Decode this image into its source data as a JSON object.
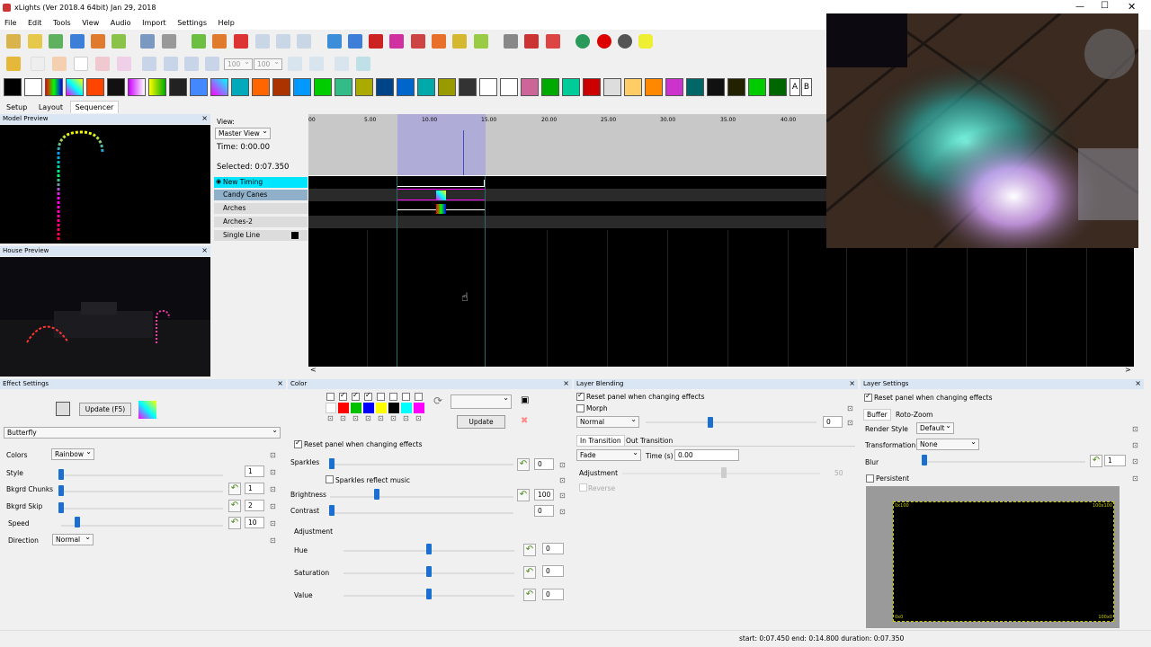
{
  "window": {
    "title": "xLights  (Ver 2018.4 64bit) Jan 29, 2018"
  },
  "menu": [
    "File",
    "Edit",
    "Tools",
    "View",
    "Audio",
    "Import",
    "Settings",
    "Help"
  ],
  "toolbar": {
    "zoom_a": "100",
    "zoom_b": "100"
  },
  "effects_bar": {
    "letter_a": "A",
    "letter_b": "B"
  },
  "tabs": [
    "Setup",
    "Layout",
    "Sequencer"
  ],
  "model_preview": {
    "title": "Model Preview",
    "close": "×"
  },
  "house_preview": {
    "title": "House Preview",
    "close": "×"
  },
  "sequencer": {
    "view_label": "View:",
    "view_value": "Master View",
    "time_label": "Time: 0:00.00",
    "selected_label": "Selected: 0:07.350",
    "ruler": [
      "00",
      "5.00",
      "10.00",
      "15.00",
      "20.00",
      "25.00",
      "30.00",
      "35.00",
      "40.00"
    ],
    "rows": [
      {
        "name": "New Timing"
      },
      {
        "name": "Candy Canes"
      },
      {
        "name": "Arches"
      },
      {
        "name": "Arches-2"
      },
      {
        "name": "Single Line"
      }
    ],
    "scroll_left": "<",
    "scroll_right": ">"
  },
  "effect_settings": {
    "title": "Effect Settings",
    "update_btn": "Update (F5)",
    "effect": "Butterfly",
    "colors_label": "Colors",
    "colors_value": "Rainbow",
    "style_label": "Style",
    "style_value": "1",
    "chunks_label": "Bkgrd Chunks",
    "chunks_value": "1",
    "skip_label": "Bkgrd Skip",
    "skip_value": "2",
    "speed_label": "Speed",
    "speed_value": "10",
    "direction_label": "Direction",
    "direction_value": "Normal",
    "style_level": 0.0,
    "chunks_level": 0.0,
    "skip_level": 0.0,
    "speed_level": 0.1
  },
  "color": {
    "title": "Color",
    "swatches": [
      "#ffffff",
      "#ff0000",
      "#00c000",
      "#0000ff",
      "#ffff00",
      "#000000",
      "#00ffff",
      "#ff00ff"
    ],
    "update_btn": "Update",
    "reset_label": "Reset panel when changing effects",
    "sparkles_label": "Sparkles",
    "sparkles_value": "0",
    "sparkles_music": "Sparkles reflect music",
    "brightness_label": "Brightness",
    "brightness_value": "100",
    "contrast_label": "Contrast",
    "contrast_value": "0",
    "adjustment_label": "Adjustment",
    "hue_label": "Hue",
    "hue_value": "0",
    "sat_label": "Saturation",
    "sat_value": "0",
    "val_label": "Value",
    "val_value": "0"
  },
  "blending": {
    "title": "Layer Blending",
    "reset_label": "Reset panel when changing effects",
    "morph_label": "Morph",
    "mode": "Normal",
    "mix_value": "0",
    "tab_in": "In Transition",
    "tab_out": "Out Transition",
    "fade": "Fade",
    "time_label": "Time (s)",
    "time_value": "0.00",
    "adjustment_label": "Adjustment",
    "adjustment_value": "50",
    "reverse_label": "Reverse"
  },
  "layer": {
    "title": "Layer Settings",
    "reset_label": "Reset panel when changing effects",
    "tab_buffer": "Buffer",
    "tab_roto": "Roto-Zoom",
    "render_label": "Render Style",
    "render_value": "Default",
    "transform_label": "Transformation",
    "transform_value": "None",
    "blur_label": "Blur",
    "blur_value": "1",
    "persistent_label": "Persistent",
    "corner_tl": "0x100",
    "corner_tr": "100x100",
    "corner_bl": "0x0",
    "corner_br": "100x0"
  },
  "status": {
    "text": "start: 0:07.450 end: 0:14.800 duration: 0:07.350"
  }
}
